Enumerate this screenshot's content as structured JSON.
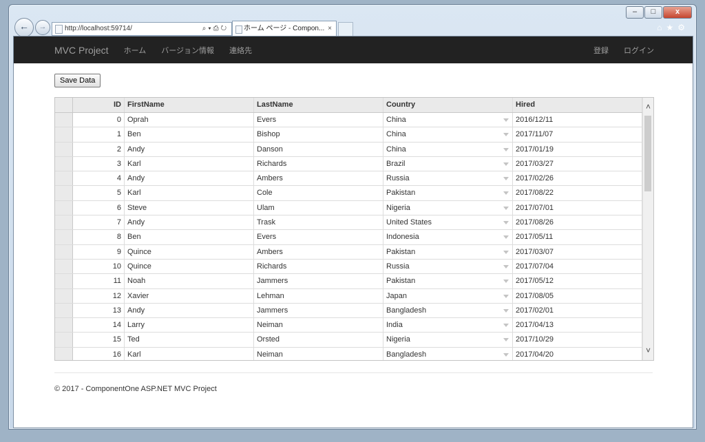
{
  "browser": {
    "url": "http://localhost:59714/",
    "addr_tools": "⌕▾⎙↻",
    "tab_title": "ホーム ページ - Compon...",
    "tab_close": "×",
    "back_icon": "←",
    "fwd_icon": "→",
    "tools_icons": "⌂★⚙",
    "win_min": "–",
    "win_max": "□",
    "win_close": "x"
  },
  "navbar": {
    "brand": "MVC Project",
    "links": [
      "ホーム",
      "バージョン情報",
      "連絡先"
    ],
    "right_links": [
      "登録",
      "ログイン"
    ]
  },
  "toolbar": {
    "save_label": "Save Data"
  },
  "grid": {
    "columns": [
      "ID",
      "FirstName",
      "LastName",
      "Country",
      "Hired"
    ],
    "rows": [
      [
        "0",
        "Oprah",
        "Evers",
        "China",
        "2016/12/11"
      ],
      [
        "1",
        "Ben",
        "Bishop",
        "China",
        "2017/11/07"
      ],
      [
        "2",
        "Andy",
        "Danson",
        "China",
        "2017/01/19"
      ],
      [
        "3",
        "Karl",
        "Richards",
        "Brazil",
        "2017/03/27"
      ],
      [
        "4",
        "Andy",
        "Ambers",
        "Russia",
        "2017/02/26"
      ],
      [
        "5",
        "Karl",
        "Cole",
        "Pakistan",
        "2017/08/22"
      ],
      [
        "6",
        "Steve",
        "Ulam",
        "Nigeria",
        "2017/07/01"
      ],
      [
        "7",
        "Andy",
        "Trask",
        "United States",
        "2017/08/26"
      ],
      [
        "8",
        "Ben",
        "Evers",
        "Indonesia",
        "2017/05/11"
      ],
      [
        "9",
        "Quince",
        "Ambers",
        "Pakistan",
        "2017/03/07"
      ],
      [
        "10",
        "Quince",
        "Richards",
        "Russia",
        "2017/07/04"
      ],
      [
        "11",
        "Noah",
        "Jammers",
        "Pakistan",
        "2017/05/12"
      ],
      [
        "12",
        "Xavier",
        "Lehman",
        "Japan",
        "2017/08/05"
      ],
      [
        "13",
        "Andy",
        "Jammers",
        "Bangladesh",
        "2017/02/01"
      ],
      [
        "14",
        "Larry",
        "Neiman",
        "India",
        "2017/04/13"
      ],
      [
        "15",
        "Ted",
        "Orsted",
        "Nigeria",
        "2017/10/29"
      ],
      [
        "16",
        "Karl",
        "Neiman",
        "Bangladesh",
        "2017/04/20"
      ]
    ],
    "scroll_up": "˄",
    "scroll_down": "˅"
  },
  "footer": {
    "text": "© 2017 - ComponentOne ASP.NET MVC Project"
  }
}
